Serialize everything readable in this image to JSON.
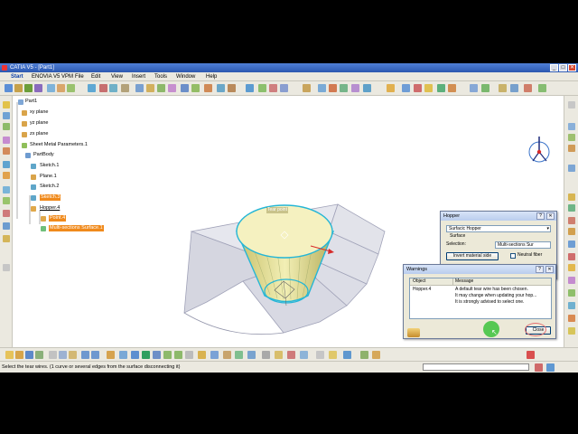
{
  "window": {
    "title": "CATIA V5 - [Part1]",
    "minimize": "_",
    "maximize": "□",
    "close": "✕",
    "accent": "#2c58b0"
  },
  "menu": {
    "items": [
      "Start",
      "ENOVIA V5 VPM",
      "File",
      "Edit",
      "View",
      "Insert",
      "Tools",
      "Window",
      "Help"
    ]
  },
  "tree": {
    "root": "Part1",
    "nodes": [
      "xy plane",
      "yz plane",
      "zx plane",
      "Sheet Metal Parameters.1",
      "PartBody",
      "Sketch.1",
      "Plane.1",
      "Sketch.2",
      "Sketch.3",
      "Hopper.4",
      "Point.4",
      "Multi-sections Surface.1"
    ]
  },
  "viewport": {
    "label": "Tear point"
  },
  "hopper_dialog": {
    "title": "Hopper",
    "help": "?",
    "close": "✕",
    "type_value": "Surfacic Hopper",
    "surface_label": "Surface",
    "selection_label": "Selection:",
    "selection_value": "Multi-sections Sur",
    "invert_button": "Invert material side",
    "neutral_fiber": "Neutral fiber"
  },
  "warnings_dialog": {
    "title": "Warnings",
    "help": "?",
    "close": "✕",
    "col_object": "Object",
    "col_message": "Message",
    "row_object": "Hopper.4",
    "msg_line1": "A default tear wire has been chosen.",
    "msg_line2": "It may change when updating your hop...",
    "msg_line3": "It is strongly advised to select one.",
    "close_button": "Close"
  },
  "status": {
    "text": "Select the tear wires. (1 curve or several edges from the surface disconnecting it)"
  },
  "colors": {
    "highlight": "#f08a1c",
    "surface_edge": "#25b6d6",
    "cone_fill": "#e8e48e",
    "flat_pattern": "#d5d6e0",
    "cursor_circle": "#3cc23c"
  }
}
